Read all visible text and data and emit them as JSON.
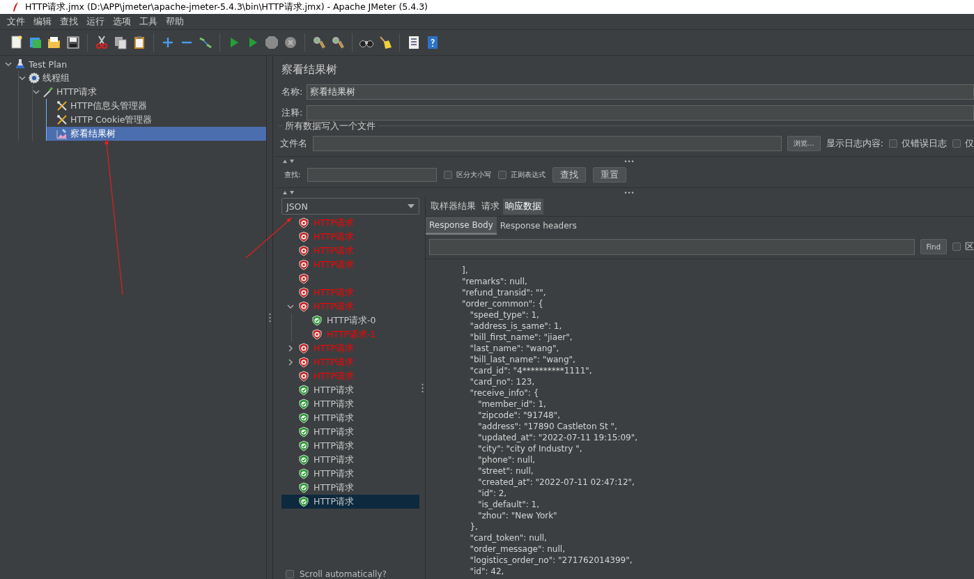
{
  "window": {
    "title": "HTTP请求.jmx (D:\\APP\\jmeter\\apache-jmeter-5.4.3\\bin\\HTTP请求.jmx) - Apache JMeter (5.4.3)"
  },
  "menu": [
    "文件",
    "编辑",
    "查找",
    "运行",
    "选项",
    "工具",
    "帮助"
  ],
  "test_tree": [
    {
      "label": "Test Plan",
      "kind": "plan",
      "expanded": true,
      "selected": false,
      "children": [
        {
          "label": "线程组",
          "kind": "group",
          "expanded": true,
          "selected": false,
          "children": [
            {
              "label": "HTTP请求",
              "kind": "sampler",
              "expanded": true,
              "selected": false,
              "children": [
                {
                  "label": "HTTP信息头管理器",
                  "kind": "config",
                  "selected": false
                },
                {
                  "label": "HTTP Cookie管理器",
                  "kind": "config",
                  "selected": false
                },
                {
                  "label": "察看结果树",
                  "kind": "listener",
                  "selected": true
                }
              ]
            }
          ]
        }
      ]
    }
  ],
  "panel": {
    "title": "察看结果树",
    "name_label": "名称:",
    "name_value": "察看结果树",
    "comment_label": "注释:",
    "file_group": "所有数据写入一个文件",
    "file_label": "文件名",
    "browse_button": "浏览...",
    "log_label": "显示日志内容:",
    "log_options": [
      {
        "label": "仅错误日志",
        "checked": false
      },
      {
        "label": "仅",
        "checked": false
      }
    ]
  },
  "search": {
    "label": "查找:",
    "options": [
      {
        "label": "区分大小写",
        "checked": false
      },
      {
        "label": "正则表达式",
        "checked": false
      }
    ],
    "buttons": [
      "查找",
      "重置"
    ]
  },
  "renderer": {
    "value": "JSON"
  },
  "results": [
    {
      "label": "HTTP请求",
      "kind": "fail",
      "selected": false
    },
    {
      "label": "HTTP请求",
      "kind": "fail",
      "selected": false
    },
    {
      "label": "HTTP请求",
      "kind": "fail",
      "selected": false
    },
    {
      "label": "HTTP请求",
      "kind": "fail",
      "selected": false
    },
    {
      "kind": "fail",
      "selected": false
    },
    {
      "label": "HTTP请求",
      "kind": "fail",
      "selected": false
    },
    {
      "label": "HTTP请求",
      "kind": "fail",
      "selected": false,
      "expanded": true,
      "children": [
        {
          "label": "HTTP请求-0",
          "kind": "pass",
          "selected": false
        },
        {
          "label": "HTTP请求-1",
          "kind": "fail",
          "selected": false
        }
      ]
    },
    {
      "label": "HTTP请求",
      "kind": "fail",
      "selected": false,
      "expanded": false
    },
    {
      "label": "HTTP请求",
      "kind": "fail",
      "selected": false,
      "expanded": false
    },
    {
      "label": "HTTP请求",
      "kind": "fail",
      "selected": false
    },
    {
      "label": "HTTP请求",
      "kind": "pass",
      "selected": false
    },
    {
      "label": "HTTP请求",
      "kind": "pass",
      "selected": false
    },
    {
      "label": "HTTP请求",
      "kind": "pass",
      "selected": false
    },
    {
      "label": "HTTP请求",
      "kind": "pass",
      "selected": false
    },
    {
      "label": "HTTP请求",
      "kind": "pass",
      "selected": false
    },
    {
      "label": "HTTP请求",
      "kind": "pass",
      "selected": false
    },
    {
      "label": "HTTP请求",
      "kind": "pass",
      "selected": false
    },
    {
      "label": "HTTP请求",
      "kind": "pass",
      "selected": false
    },
    {
      "label": "HTTP请求",
      "kind": "pass",
      "selected": true
    }
  ],
  "scroll_option": {
    "label": "Scroll automatically?",
    "checked": false
  },
  "tabs": [
    {
      "label": "取样器结果",
      "selected": false
    },
    {
      "label": "请求",
      "selected": false
    },
    {
      "label": "响应数据",
      "selected": true
    }
  ],
  "subtabs": [
    {
      "label": "Response Body",
      "selected": true
    },
    {
      "label": "Response headers",
      "selected": false
    }
  ],
  "find": {
    "button": "Find",
    "option": {
      "label": "区",
      "checked": false
    }
  },
  "response_lines": [
    "],",
    "\"remarks\": null,",
    "\"refund_transid\": \"\",",
    "\"order_common\": {",
    "   \"speed_type\": 1,",
    "   \"address_is_same\": 1,",
    "   \"bill_first_name\": \"jiaer\",",
    "   \"last_name\": \"wang\",",
    "   \"bill_last_name\": \"wang\",",
    "   \"card_id\": \"4**********1111\",",
    "   \"card_no\": 123,",
    "   \"receive_info\": {",
    "      \"member_id\": 1,",
    "      \"zipcode\": \"91748\",",
    "      \"address\": \"17890 Castleton St \",",
    "      \"updated_at\": \"2022-07-11 19:15:09\",",
    "      \"city\": \"city of Industry \",",
    "      \"phone\": null,",
    "      \"street\": null,",
    "      \"created_at\": \"2022-07-11 02:47:12\",",
    "      \"id\": 2,",
    "      \"is_default\": 1,",
    "      \"zhou\": \"New York\"",
    "   },",
    "   \"card_token\": null,",
    "   \"order_message\": null,",
    "   \"logistics_order_no\": \"271762014399\",",
    "   \"id\": 42,"
  ]
}
